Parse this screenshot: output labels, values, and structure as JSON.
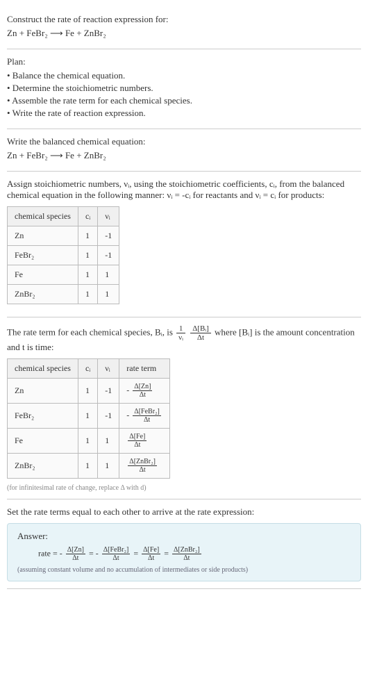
{
  "header": {
    "prompt": "Construct the rate of reaction expression for:",
    "equation": "Zn + FeBr₂ ⟶ Fe + ZnBr₂"
  },
  "plan": {
    "title": "Plan:",
    "items": [
      "• Balance the chemical equation.",
      "• Determine the stoichiometric numbers.",
      "• Assemble the rate term for each chemical species.",
      "• Write the rate of reaction expression."
    ]
  },
  "balanced": {
    "title": "Write the balanced chemical equation:",
    "equation": "Zn + FeBr₂ ⟶ Fe + ZnBr₂"
  },
  "stoich": {
    "intro": "Assign stoichiometric numbers, νᵢ, using the stoichiometric coefficients, cᵢ, from the balanced chemical equation in the following manner: νᵢ = -cᵢ for reactants and νᵢ = cᵢ for products:",
    "headers": [
      "chemical species",
      "cᵢ",
      "νᵢ"
    ],
    "rows": [
      {
        "species": "Zn",
        "c": "1",
        "v": "-1"
      },
      {
        "species": "FeBr₂",
        "c": "1",
        "v": "-1"
      },
      {
        "species": "Fe",
        "c": "1",
        "v": "1"
      },
      {
        "species": "ZnBr₂",
        "c": "1",
        "v": "1"
      }
    ]
  },
  "rateterm": {
    "intro_a": "The rate term for each chemical species, Bᵢ, is ",
    "intro_b": " where [Bᵢ] is the amount concentration and t is time:",
    "frac_outer_num": "1",
    "frac_outer_den": "νᵢ",
    "frac_inner_num": "Δ[Bᵢ]",
    "frac_inner_den": "Δt",
    "headers": [
      "chemical species",
      "cᵢ",
      "νᵢ",
      "rate term"
    ],
    "rows": [
      {
        "species": "Zn",
        "c": "1",
        "v": "-1",
        "term_num": "Δ[Zn]",
        "term_den": "Δt",
        "neg": "-"
      },
      {
        "species": "FeBr₂",
        "c": "1",
        "v": "-1",
        "term_num": "Δ[FeBr₂]",
        "term_den": "Δt",
        "neg": "-"
      },
      {
        "species": "Fe",
        "c": "1",
        "v": "1",
        "term_num": "Δ[Fe]",
        "term_den": "Δt",
        "neg": ""
      },
      {
        "species": "ZnBr₂",
        "c": "1",
        "v": "1",
        "term_num": "Δ[ZnBr₂]",
        "term_den": "Δt",
        "neg": ""
      }
    ],
    "note": "(for infinitesimal rate of change, replace Δ with d)"
  },
  "final": {
    "title": "Set the rate terms equal to each other to arrive at the rate expression:",
    "answer_label": "Answer:",
    "rate_label": "rate = ",
    "terms": [
      {
        "neg": "-",
        "num": "Δ[Zn]",
        "den": "Δt"
      },
      {
        "neg": "-",
        "num": "Δ[FeBr₂]",
        "den": "Δt"
      },
      {
        "neg": "",
        "num": "Δ[Fe]",
        "den": "Δt"
      },
      {
        "neg": "",
        "num": "Δ[ZnBr₂]",
        "den": "Δt"
      }
    ],
    "eq": " = ",
    "note": "(assuming constant volume and no accumulation of intermediates or side products)"
  }
}
